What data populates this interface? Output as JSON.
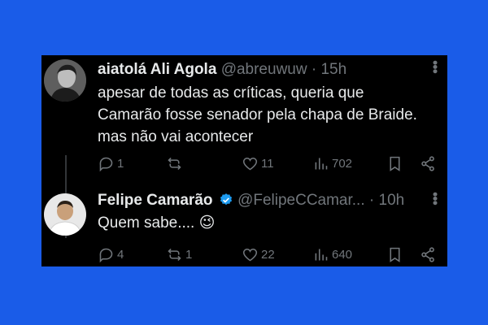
{
  "tweets": [
    {
      "display_name": "aiatolá Ali Agola",
      "handle": "@abreuwuw",
      "separator": "·",
      "time": "15h",
      "text_lines": [
        "apesar de todas as críticas, queria que",
        "Camarão fosse senador pela chapa de Braide.",
        "mas não vai acontecer"
      ],
      "replies": "1",
      "reposts": "",
      "likes": "11",
      "views": "702"
    },
    {
      "display_name": "Felipe Camarão",
      "verified": true,
      "handle": "@FelipeCCamar...",
      "separator": "·",
      "time": "10h",
      "text_lines": [
        "Quem sabe.... 😉"
      ],
      "replies": "4",
      "reposts": "1",
      "likes": "22",
      "views": "640"
    }
  ],
  "colors": {
    "background": "#1a5ce8",
    "card": "#000000",
    "text": "#e7e9ea",
    "muted": "#71767b",
    "verified": "#1d9bf0"
  },
  "icons": [
    "reply-icon",
    "repost-icon",
    "like-icon",
    "views-icon",
    "bookmark-icon",
    "share-icon",
    "more-icon",
    "verified-badge-icon"
  ]
}
